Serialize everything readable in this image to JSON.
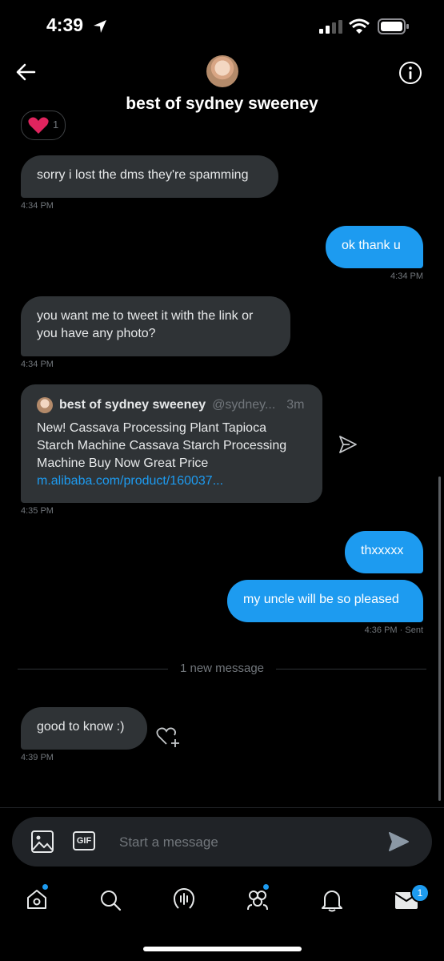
{
  "status_bar": {
    "time": "4:39"
  },
  "header": {
    "title": "best of sydney sweeney"
  },
  "messages": [
    {
      "text": "sorry i lost the dms they're spamming",
      "time": "4:34 PM"
    },
    {
      "text": "ok thank u",
      "time": "4:34 PM"
    },
    {
      "text": "you want me to tweet it with the link or you have any photo?",
      "time": "4:34 PM"
    },
    {
      "time": "4:35 PM"
    },
    {
      "text": "thxxxxx"
    },
    {
      "text": "my uncle will be so pleased",
      "time": "4:36 PM · Sent"
    },
    {
      "text": "good to know :)",
      "time": "4:39 PM"
    }
  ],
  "tweet_card": {
    "author": "best of sydney sweeney",
    "handle": "@sydney...",
    "age": "3m",
    "text": "New! Cassava Processing Plant Tapioca Starch Machine Cassava Starch Processing Machine Buy Now Great Price",
    "link": "m.alibaba.com/product/160037..."
  },
  "reaction": {
    "count": "1"
  },
  "divider": {
    "label": "1 new message"
  },
  "composer": {
    "placeholder": "Start a message",
    "gif_label": "GIF"
  },
  "tabbar": {
    "messages_badge": "1"
  },
  "colors": {
    "accent": "#1d9bf0",
    "bubble_received": "#2f3336",
    "background": "#000000"
  }
}
